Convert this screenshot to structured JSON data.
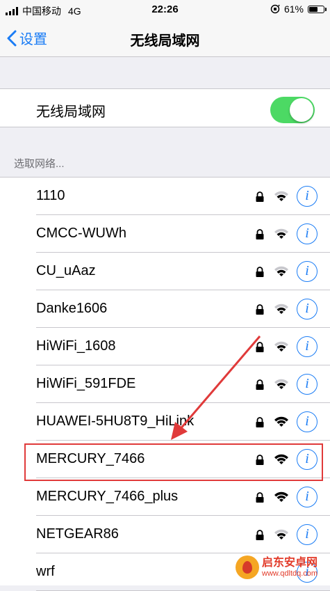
{
  "status_bar": {
    "carrier": "中国移动",
    "network": "4G",
    "time": "22:26",
    "battery": "61%",
    "battery_level": 0.61
  },
  "nav": {
    "back_label": "设置",
    "title": "无线局域网"
  },
  "wifi_toggle": {
    "label": "无线局域网",
    "on": true,
    "color": "#4cd964"
  },
  "networks_header": "选取网络...",
  "networks": [
    {
      "name": "1110",
      "locked": true,
      "signal": "medium"
    },
    {
      "name": "CMCC-WUWh",
      "locked": true,
      "signal": "medium"
    },
    {
      "name": "CU_uAaz",
      "locked": true,
      "signal": "medium"
    },
    {
      "name": "Danke1606",
      "locked": true,
      "signal": "medium"
    },
    {
      "name": "HiWiFi_1608",
      "locked": true,
      "signal": "medium"
    },
    {
      "name": "HiWiFi_591FDE",
      "locked": true,
      "signal": "medium"
    },
    {
      "name": "HUAWEI-5HU8T9_HiLink",
      "locked": true,
      "signal": "full"
    },
    {
      "name": "MERCURY_7466",
      "locked": true,
      "signal": "full"
    },
    {
      "name": "MERCURY_7466_plus",
      "locked": true,
      "signal": "full"
    },
    {
      "name": "NETGEAR86",
      "locked": true,
      "signal": "medium"
    },
    {
      "name": "wrf",
      "locked": false,
      "signal": "none"
    }
  ],
  "info_glyph": "i",
  "highlighted_network": "MERCURY_7466",
  "annotation_color": "#e03a3a",
  "accent_color": "#1a7cf5",
  "watermark": {
    "title": "启东安卓网",
    "url": "www.qdltdq.com"
  }
}
